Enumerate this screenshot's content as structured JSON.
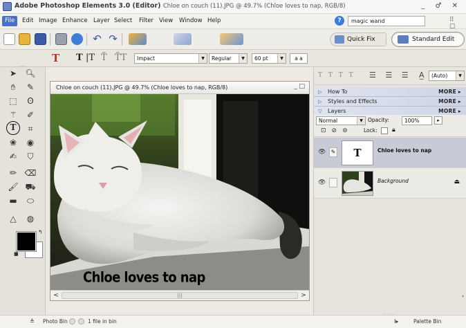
{
  "titlebar": {
    "app_title": "Adobe Photoshop Elements 3.0 (Editor)",
    "doc_info": "Chloe on couch (11).JPG @ 49.7% (Chloe loves to nap, RGB/8)",
    "controls": "_ ♂ ✕"
  },
  "menu": {
    "items": [
      "File",
      "Edit",
      "Image",
      "Enhance",
      "Layer",
      "Select",
      "Filter",
      "View",
      "Window",
      "Help"
    ],
    "search_value": "magic wand",
    "right_icons": "⠿ ☐"
  },
  "shortcuts": {
    "quick_fix_label": "Quick Fix",
    "standard_edit_label": "Standard Edit"
  },
  "options": {
    "tool_glyph": "T",
    "type_glyphs": [
      "T",
      "|T",
      "T̃",
      "T̃T"
    ],
    "font_family": "Impact",
    "font_style": "Regular",
    "font_size": "60 pt",
    "aa_label": "a a"
  },
  "document": {
    "window_title": "Chloe on couch (11).JPG @ 49.7% (Chloe loves to nap, RGB/8)",
    "window_control": "_ □",
    "caption": "Chloe loves to nap",
    "scroll_left": "<",
    "scroll_right": ">",
    "scroll_thumb": "|||"
  },
  "palette": {
    "format_glyphs": "T T T T",
    "align_glyphs": "☰ ☰ ☰",
    "leading": "(Auto)",
    "panels": [
      {
        "name": "How To",
        "more": "MORE ▸",
        "expanded": false
      },
      {
        "name": "Styles and Effects",
        "more": "MORE ▸",
        "expanded": false
      },
      {
        "name": "Layers",
        "more": "MORE ▸",
        "expanded": true
      }
    ],
    "blend_mode": "Normal",
    "opacity_label": "Opacity:",
    "opacity_value": "100%",
    "lock_label": "Lock:",
    "layers": [
      {
        "name": "Chloe loves to nap",
        "type_glyph": "T",
        "selected": true
      },
      {
        "name": "Background",
        "type_glyph": "",
        "selected": false,
        "lock_icon": "⏏"
      }
    ]
  },
  "status": {
    "photo_bin_label": "Photo Bin",
    "file_count": "1 file in bin",
    "palette_bin_label": "Palette Bin"
  },
  "colors": {
    "accent": "#4a6fc7",
    "selected_layer": "#c8cad6",
    "foreground_color": "#000000",
    "background_color": "#ffffff"
  }
}
